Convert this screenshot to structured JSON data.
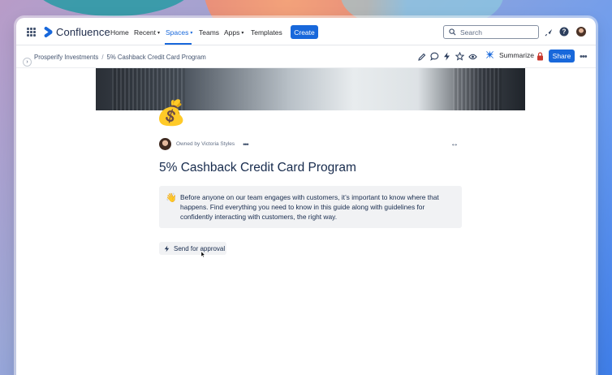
{
  "app": {
    "logo_text": "Confluence"
  },
  "topnav": {
    "items": [
      {
        "label": "Home"
      },
      {
        "label": "Recent"
      },
      {
        "label": "Spaces"
      },
      {
        "label": "Teams"
      },
      {
        "label": "Apps"
      },
      {
        "label": "Templates"
      }
    ],
    "create_label": "Create",
    "search_placeholder": "Search"
  },
  "breadcrumb": {
    "items": [
      "Prosperify Investments",
      "5% Cashback Credit Card Program"
    ],
    "separator": "/"
  },
  "toolbar": {
    "summarize_label": "Summarize",
    "share_label": "Share"
  },
  "page": {
    "owner_text": "Owned by Victoria Styles",
    "title": "5% Cashback Credit Card Program",
    "cover_emoji": "💰",
    "panel_emoji": "👋",
    "panel_text": "Before anyone on our team engages with customers, it’s important to know where that happens. Find everything you need to know in this guide along with guidelines for confidently interacting with customers, the right way.",
    "approval_label": "Send for approval"
  },
  "colors": {
    "brand": "#1868db",
    "text": "#172b4d",
    "panel_bg": "#f1f2f4",
    "restricted": "#c9372c"
  }
}
